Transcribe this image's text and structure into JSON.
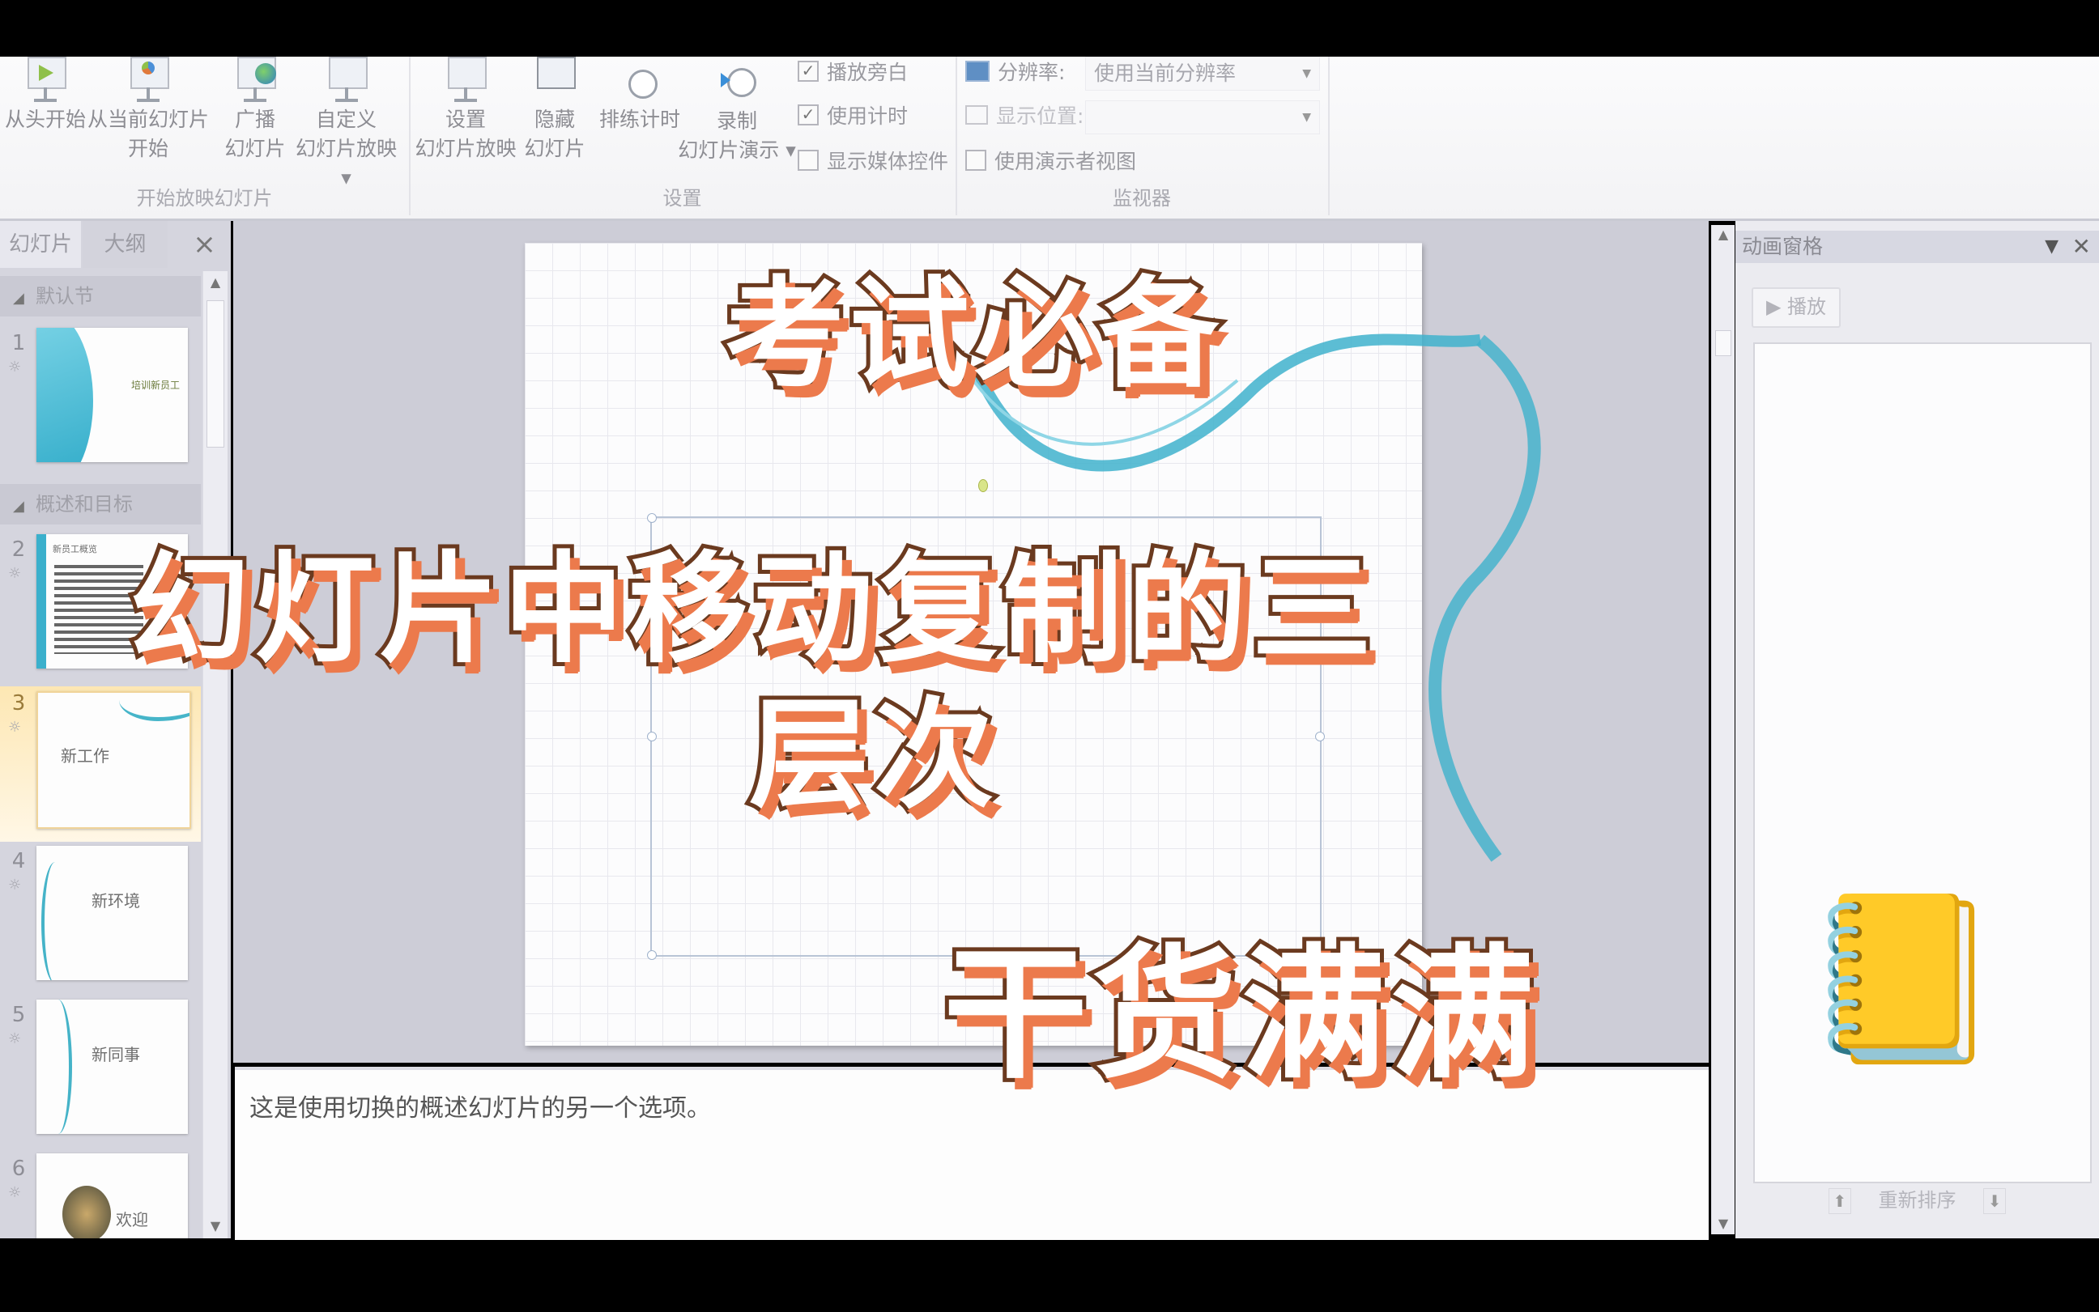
{
  "ribbon": {
    "groups": [
      {
        "label": "开始放映幻灯片"
      },
      {
        "label": "设置"
      },
      {
        "label": "监视器"
      }
    ],
    "buttons": {
      "from_beginning": "从头开始",
      "from_current_l1": "从当前幻灯片",
      "from_current_l2": "开始",
      "broadcast_l1": "广播",
      "broadcast_l2": "幻灯片",
      "custom_l1": "自定义",
      "custom_l2": "幻灯片放映 ▾",
      "setup_l1": "设置",
      "setup_l2": "幻灯片放映",
      "hide_l1": "隐藏",
      "hide_l2": "幻灯片",
      "rehearse": "排练计时",
      "record_l1": "录制",
      "record_l2": "幻灯片演示 ▾"
    },
    "checkboxes": [
      {
        "label": "播放旁白",
        "checked": true
      },
      {
        "label": "使用计时",
        "checked": true
      },
      {
        "label": "显示媒体控件",
        "checked": false
      }
    ],
    "monitor": {
      "resolution_label": "分辨率:",
      "resolution_value": "使用当前分辨率",
      "show_on_label": "显示位置:",
      "show_on_value": "",
      "presenter_view": {
        "label": "使用演示者视图",
        "checked": false
      }
    }
  },
  "left_panel": {
    "tabs": [
      {
        "label": "幻灯片",
        "active": true
      },
      {
        "label": "大纲",
        "active": false
      }
    ],
    "close_icon": "×",
    "sections": [
      {
        "label": "默认节"
      },
      {
        "label": "概述和目标"
      }
    ],
    "slides": [
      {
        "number": "1",
        "title": "培训新员工",
        "selected": false
      },
      {
        "number": "2",
        "title": "新员工概览",
        "selected": false
      },
      {
        "number": "3",
        "title": "新工作",
        "selected": true
      },
      {
        "number": "4",
        "title": "新环境",
        "selected": false
      },
      {
        "number": "5",
        "title": "新同事",
        "selected": false
      },
      {
        "number": "6",
        "title": "欢迎",
        "selected": false
      }
    ],
    "star_glyph": "☼"
  },
  "notes": {
    "text": "这是使用切换的概述幻灯片的另一个选项。"
  },
  "animation_pane": {
    "title": "动画窗格",
    "play_label": "▶ 播放",
    "reorder_label": "重新排序"
  },
  "overlay": {
    "line1": "考试必备",
    "line2": "幻灯片中移动复制的三",
    "line3": "层次",
    "line4": "干货满满",
    "emoji": "📒",
    "colors": {
      "fill": "#ffffff",
      "outline": "#6b3a1f",
      "shadow": "#ec7a4c"
    }
  }
}
